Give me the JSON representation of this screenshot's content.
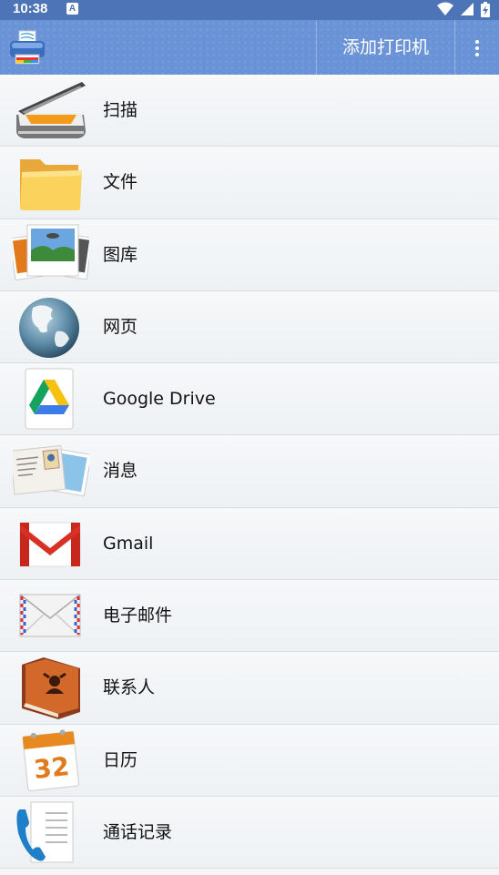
{
  "status_bar": {
    "time": "10:38",
    "notification_badge": "A",
    "icons": [
      "wifi-icon",
      "signal-icon",
      "battery-charging-icon"
    ]
  },
  "app_bar": {
    "logo_icon": "printer-logo-icon",
    "add_printer_label": "添加打印机",
    "menu_icon": "overflow-menu-icon"
  },
  "menu_items": [
    {
      "label": "扫描",
      "icon": "scanner-icon"
    },
    {
      "label": "文件",
      "icon": "folder-icon"
    },
    {
      "label": "图库",
      "icon": "gallery-icon"
    },
    {
      "label": "网页",
      "icon": "globe-icon"
    },
    {
      "label": "Google Drive",
      "icon": "google-drive-icon"
    },
    {
      "label": "消息",
      "icon": "messages-icon"
    },
    {
      "label": "Gmail",
      "icon": "gmail-icon"
    },
    {
      "label": "电子邮件",
      "icon": "email-envelope-icon"
    },
    {
      "label": "联系人",
      "icon": "contacts-book-icon"
    },
    {
      "label": "日历",
      "icon": "calendar-icon"
    },
    {
      "label": "通话记录",
      "icon": "call-log-icon"
    }
  ],
  "calendar_icon_text": "32",
  "colors": {
    "status_bar": "#4e74b8",
    "app_bar": "#6a92d6"
  }
}
